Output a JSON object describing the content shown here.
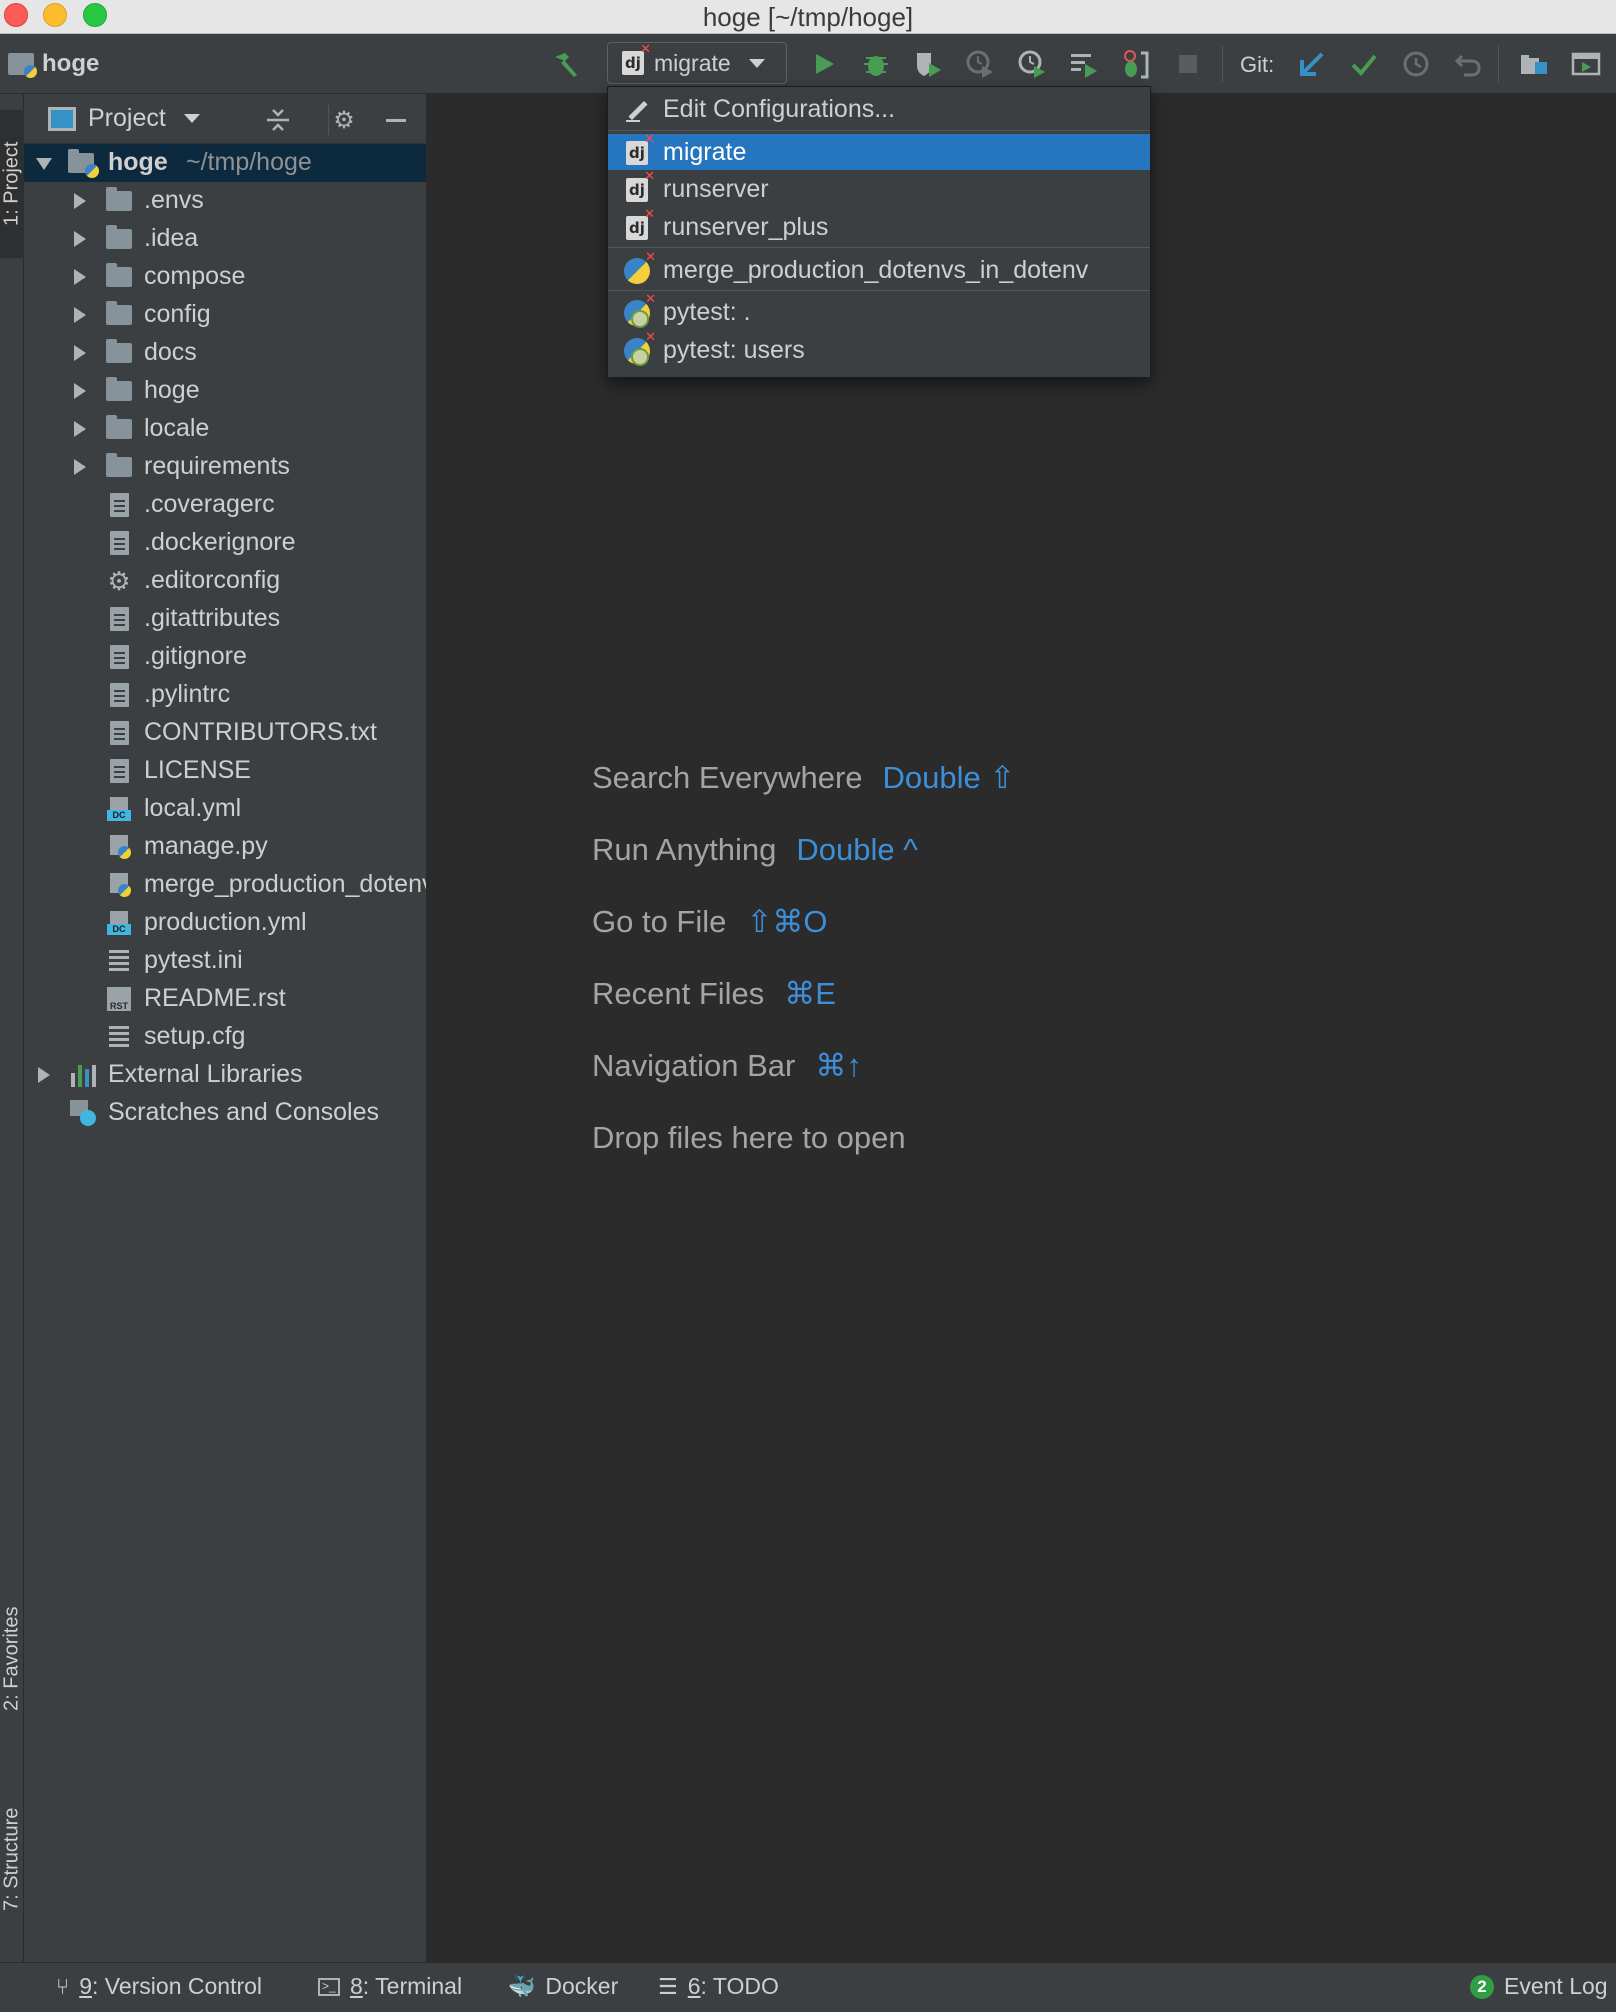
{
  "window": {
    "title": "hoge [~/tmp/hoge]"
  },
  "toolbar": {
    "project_name": "hoge",
    "run_config": "migrate",
    "git_label": "Git:"
  },
  "run_menu": {
    "edit_configurations": "Edit Configurations...",
    "items": [
      {
        "label": "migrate",
        "icon": "django-icon",
        "selected": true
      },
      {
        "label": "runserver",
        "icon": "django-icon"
      },
      {
        "label": "runserver_plus",
        "icon": "django-icon"
      },
      {
        "label": "merge_production_dotenvs_in_dotenv",
        "icon": "python-icon"
      },
      {
        "label": "pytest: .",
        "icon": "pytest-icon"
      },
      {
        "label": "pytest: users",
        "icon": "pytest-icon"
      }
    ]
  },
  "left_strip": {
    "project_tab": "1: Project",
    "favorites_tab": "2: Favorites",
    "structure_tab": "7: Structure"
  },
  "project_panel": {
    "title": "Project",
    "root": {
      "name": "hoge",
      "path": "~/tmp/hoge"
    },
    "items": [
      {
        "label": ".envs",
        "type": "folder"
      },
      {
        "label": ".idea",
        "type": "folder"
      },
      {
        "label": "compose",
        "type": "folder"
      },
      {
        "label": "config",
        "type": "folder"
      },
      {
        "label": "docs",
        "type": "folder"
      },
      {
        "label": "hoge",
        "type": "folder"
      },
      {
        "label": "locale",
        "type": "folder"
      },
      {
        "label": "requirements",
        "type": "folder"
      },
      {
        "label": ".coveragerc",
        "type": "file"
      },
      {
        "label": ".dockerignore",
        "type": "file"
      },
      {
        "label": ".editorconfig",
        "type": "config"
      },
      {
        "label": ".gitattributes",
        "type": "file"
      },
      {
        "label": ".gitignore",
        "type": "file"
      },
      {
        "label": ".pylintrc",
        "type": "file"
      },
      {
        "label": "CONTRIBUTORS.txt",
        "type": "file"
      },
      {
        "label": "LICENSE",
        "type": "file"
      },
      {
        "label": "local.yml",
        "type": "compose"
      },
      {
        "label": "manage.py",
        "type": "python"
      },
      {
        "label": "merge_production_dotenvs_in_dotenv.py",
        "type": "python"
      },
      {
        "label": "production.yml",
        "type": "compose"
      },
      {
        "label": "pytest.ini",
        "type": "ini"
      },
      {
        "label": "README.rst",
        "type": "rst"
      },
      {
        "label": "setup.cfg",
        "type": "ini"
      }
    ],
    "external_libraries": "External Libraries",
    "scratches": "Scratches and Consoles"
  },
  "editor_hints": [
    {
      "label": "Search Everywhere",
      "shortcut": "Double ⇧"
    },
    {
      "label": "Run Anything",
      "shortcut": "Double ^"
    },
    {
      "label": "Go to File",
      "shortcut": "⇧⌘O"
    },
    {
      "label": "Recent Files",
      "shortcut": "⌘E"
    },
    {
      "label": "Navigation Bar",
      "shortcut": "⌘↑"
    },
    {
      "label": "Drop files here to open",
      "shortcut": ""
    }
  ],
  "status_bar": {
    "version_control_num": "9",
    "version_control": ": Version Control",
    "terminal_num": "8",
    "terminal": ": Terminal",
    "docker": "Docker",
    "todo_num": "6",
    "todo": ": TODO",
    "event_count": "2",
    "event_log": "Event Log"
  },
  "colors": {
    "selection": "#2675bf",
    "shortcut": "#3d8fd8",
    "run_green": "#499c54",
    "vcs_blue": "#3592c4"
  }
}
